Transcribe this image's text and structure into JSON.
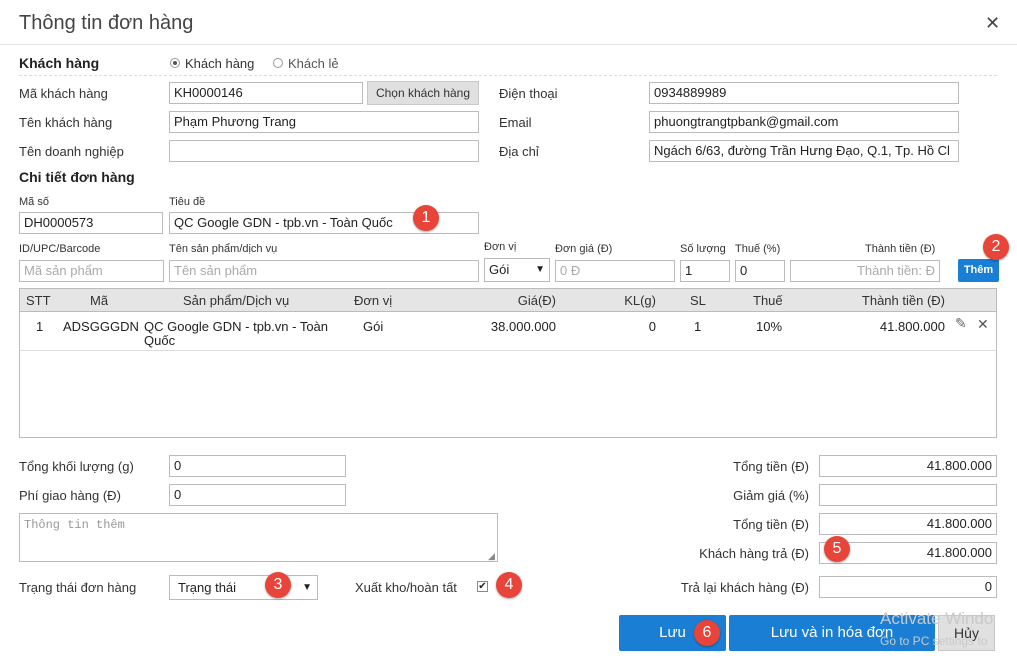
{
  "dialog": {
    "title": "Thông tin đơn hàng"
  },
  "customer": {
    "section_label": "Khách hàng",
    "radio_customer": "Khách hàng",
    "radio_walkin": "Khách lẻ",
    "code_label": "Mã khách hàng",
    "code_value": "KH0000146",
    "choose_button": "Chọn khách hàng",
    "phone_label": "Điện thoại",
    "phone_value": "0934889989",
    "name_label": "Tên khách hàng",
    "name_value": "Phạm Phương Trang",
    "email_label": "Email",
    "email_value": "phuongtrangtpbank@gmail.com",
    "company_label": "Tên doanh nghiệp",
    "company_value": "",
    "address_label": "Địa chỉ",
    "address_value": "Ngách 6/63, đường Trần Hưng Đạo, Q.1, Tp. Hồ Cl"
  },
  "order": {
    "section_label": "Chi tiết đơn hàng",
    "code_label": "Mã số",
    "code_value": "DH0000573",
    "subject_label": "Tiêu đề",
    "subject_value": "QC Google GDN - tpb.vn - Toàn Quốc"
  },
  "add_item": {
    "barcode_label": "ID/UPC/Barcode",
    "barcode_placeholder": "Mã sản phẩm",
    "product_label": "Tên sản phẩm/dịch vụ",
    "product_placeholder": "Tên sản phẩm",
    "unit_label": "Đơn vị",
    "unit_value": "Gói",
    "price_label": "Đơn giá (Đ)",
    "price_placeholder": "0 Đ",
    "qty_label": "Số lượng",
    "qty_value": "1",
    "tax_label": "Thuế (%)",
    "tax_value": "0",
    "total_label": "Thành tiền (Đ)",
    "total_placeholder": "Thành tiền: Đ",
    "add_button": "Thêm"
  },
  "table": {
    "headers": [
      "STT",
      "Mã",
      "Sản phẩm/Dịch vụ",
      "Đơn vị",
      "Giá(Đ)",
      "KL(g)",
      "SL",
      "Thuế",
      "Thành tiền (Đ)"
    ],
    "rows": [
      {
        "stt": "1",
        "code": "ADSGGGDN",
        "product_line1": "QC Google GDN - tpb.vn - Toàn",
        "product_line2": "Quốc",
        "unit": "Gói",
        "price": "38.000.000",
        "weight": "0",
        "qty": "1",
        "tax": "10%",
        "total": "41.800.000"
      }
    ]
  },
  "summary": {
    "weight_label": "Tổng khối lượng (g)",
    "weight_value": "0",
    "shipping_label": "Phí giao hàng (Đ)",
    "shipping_value": "0",
    "notes_placeholder": "Thông tin thêm",
    "subtotal_label": "Tổng tiền (Đ)",
    "subtotal_value": "41.800.000",
    "discount_label": "Giảm giá (%)",
    "discount_value": "",
    "total_label": "Tổng tiền (Đ)",
    "total_value": "41.800.000",
    "paid_label": "Khách hàng trả (Đ)",
    "paid_value": "41.800.000",
    "change_label": "Trả lại khách hàng (Đ)",
    "change_value": "0"
  },
  "status": {
    "label": "Trạng thái đơn hàng",
    "value": "Trạng thái",
    "export_label": "Xuất kho/hoàn tất"
  },
  "actions": {
    "save": "Lưu",
    "save_print": "Lưu và in hóa đơn",
    "cancel": "Hủy"
  },
  "badges": [
    "1",
    "2",
    "3",
    "4",
    "5",
    "6"
  ],
  "watermark": {
    "line1": "Activate Windo",
    "line2": "Go to PC settings to"
  },
  "colors": {
    "primary_button": "#1a7ed4",
    "badge": "#e8443a",
    "header_bg": "#e5e5e5"
  }
}
